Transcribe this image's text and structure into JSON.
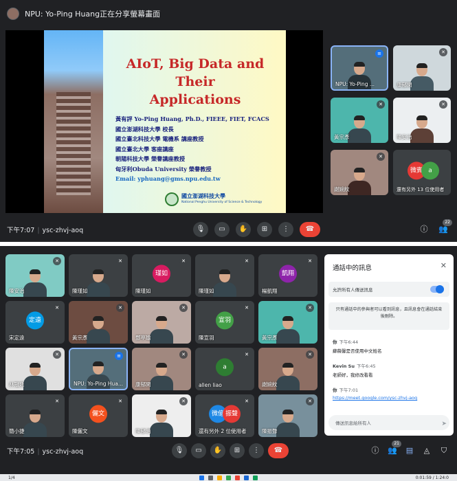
{
  "top_meeting": {
    "share_banner": "NPU: Yo-Ping Huang正在分享螢幕畫面",
    "slide": {
      "title_line1": "AIoT, Big Data and Their",
      "title_line2": "Applications",
      "lines": [
        "黃有評 Yo-Ping Huang, Ph.D., FIEEE, FIET, FCACS",
        "國立澎湖科技大學 校長",
        "國立臺北科技大學 電機系 講座教授",
        "國立臺北大學 客座講座",
        "朝陽科技大學 榮譽講座教授",
        "匈牙利Obuda University 榮譽教授"
      ],
      "email": "Email: yphuang@gms.npu.edu.tw",
      "logo_cn": "國立澎湖科技大學",
      "logo_en": "National Penghu University of Science & Technology"
    },
    "tiles": [
      {
        "label": "NPU: Yo-Ping ..."
      },
      {
        "label": "康郁閑"
      },
      {
        "label": "黃宗彥"
      },
      {
        "label": "陳安治"
      },
      {
        "label": "謝婉紋"
      },
      {
        "label": "還有另外 13 位使用者",
        "avatars": [
          "微賓",
          "a"
        ]
      }
    ],
    "controls": {
      "time": "下午7:07",
      "code": "ysc-zhvj-aoq",
      "people_count": "22"
    }
  },
  "bottom_meeting": {
    "tiles": [
      {
        "label": "陳安治"
      },
      {
        "label": "陳瑾如"
      },
      {
        "label": "陳瑾如",
        "avatar": "瑾如"
      },
      {
        "label": "陳瑾如"
      },
      {
        "label": "楊凱翔",
        "avatar": "凱翔"
      },
      {
        "label": "宋定遠",
        "avatar": "定遠"
      },
      {
        "label": "黃宗彥"
      },
      {
        "label": "鄧亭瑜"
      },
      {
        "label": "陳宣羽",
        "avatar": "宣羽"
      },
      {
        "label": "黃宗彥"
      },
      {
        "label": "林冠廷"
      },
      {
        "label": "NPU: Yo-Ping Hua..."
      },
      {
        "label": "康郁閑"
      },
      {
        "label": "allen liao",
        "avatar": "a"
      },
      {
        "label": "謝婉紋"
      },
      {
        "label": "簡小捷"
      },
      {
        "label": "陳儷文",
        "avatar": "儷文"
      },
      {
        "label": "陳郁涵"
      },
      {
        "label": "還有另外 2 位使用者",
        "avatars": [
          "微億",
          "振聲"
        ]
      },
      {
        "label": "陳振聲"
      }
    ],
    "chat": {
      "header": "通話中的訊息",
      "allow_label": "允許所有人傳送訊息",
      "notice": "只有通話中的參與者可以看到訊息，且訊息會在通話結束後刪除。",
      "messages": [
        {
          "who": "你",
          "time": "下午6:44",
          "text": "蘇薇馨是否使用中文姓名"
        },
        {
          "who": "Kevin Su",
          "time": "下午6:45",
          "text": "老師好，我修改看看"
        },
        {
          "who": "你",
          "time": "下午7:01",
          "text": "https://meet.google.com/ysc-zhvj-aoq"
        }
      ],
      "input_placeholder": "傳送訊息給所有人"
    },
    "controls": {
      "time": "下午7:05",
      "code": "ysc-zhvj-aoq",
      "people_count": "21"
    }
  },
  "taskbar": {
    "page": "1/4",
    "clock": "0:01:59 / 1:24:0"
  },
  "colors": {
    "bg": "#202124",
    "end_call": "#ea4335",
    "accent": "#1a73e8"
  }
}
